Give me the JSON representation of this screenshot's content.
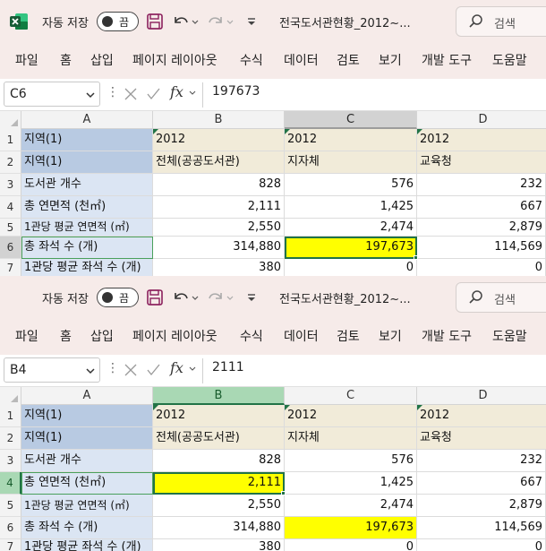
{
  "app": {
    "autosave_label": "자동 저장",
    "toggle_state": "끔",
    "doc_title": "전국도서관현황_2012~...",
    "search_placeholder": "검색"
  },
  "ribbon_tabs": [
    "파일",
    "홈",
    "삽입",
    "페이지 레이아웃",
    "수식",
    "데이터",
    "검토",
    "보기",
    "개발 도구",
    "도움말"
  ],
  "columns": [
    "A",
    "B",
    "C",
    "D"
  ],
  "rows": [
    {
      "num": "1",
      "cells": [
        "지역(1)",
        "2012",
        "2012",
        "2012"
      ]
    },
    {
      "num": "2",
      "cells": [
        "지역(1)",
        "전체(공공도서관)",
        "지자체",
        "교육청"
      ]
    },
    {
      "num": "3",
      "cells": [
        "도서관 개수",
        "828",
        "576",
        "232"
      ]
    },
    {
      "num": "4",
      "cells": [
        "총 연면적 (천㎡)",
        "2,111",
        "1,425",
        "667"
      ]
    },
    {
      "num": "5",
      "cells": [
        "1관당 평균 연면적 (㎡)",
        "2,550",
        "2,474",
        "2,879"
      ]
    },
    {
      "num": "6",
      "cells": [
        "총 좌석 수 (개)",
        "314,880",
        "197,673",
        "114,569"
      ]
    },
    {
      "num": "7",
      "cells": [
        "1관당 평균 좌석 수 (개)",
        "380",
        "0",
        "0"
      ]
    }
  ],
  "windows": [
    {
      "name_box": "C6",
      "formula": "197673"
    },
    {
      "name_box": "B4",
      "formula": "2111"
    }
  ],
  "colors": {
    "excel_green": "#217346",
    "titlebar_bg": "#f6ebe9",
    "highlight_yellow": "#ffff00",
    "label_blue": "#dbe5f3",
    "header_beige": "#f1ebd9"
  },
  "icons": [
    "excel-logo-icon",
    "save-icon",
    "undo-icon",
    "redo-icon",
    "customize-qat-icon",
    "search-icon",
    "chevron-down-icon",
    "cancel-icon",
    "enter-icon",
    "fx-icon"
  ]
}
